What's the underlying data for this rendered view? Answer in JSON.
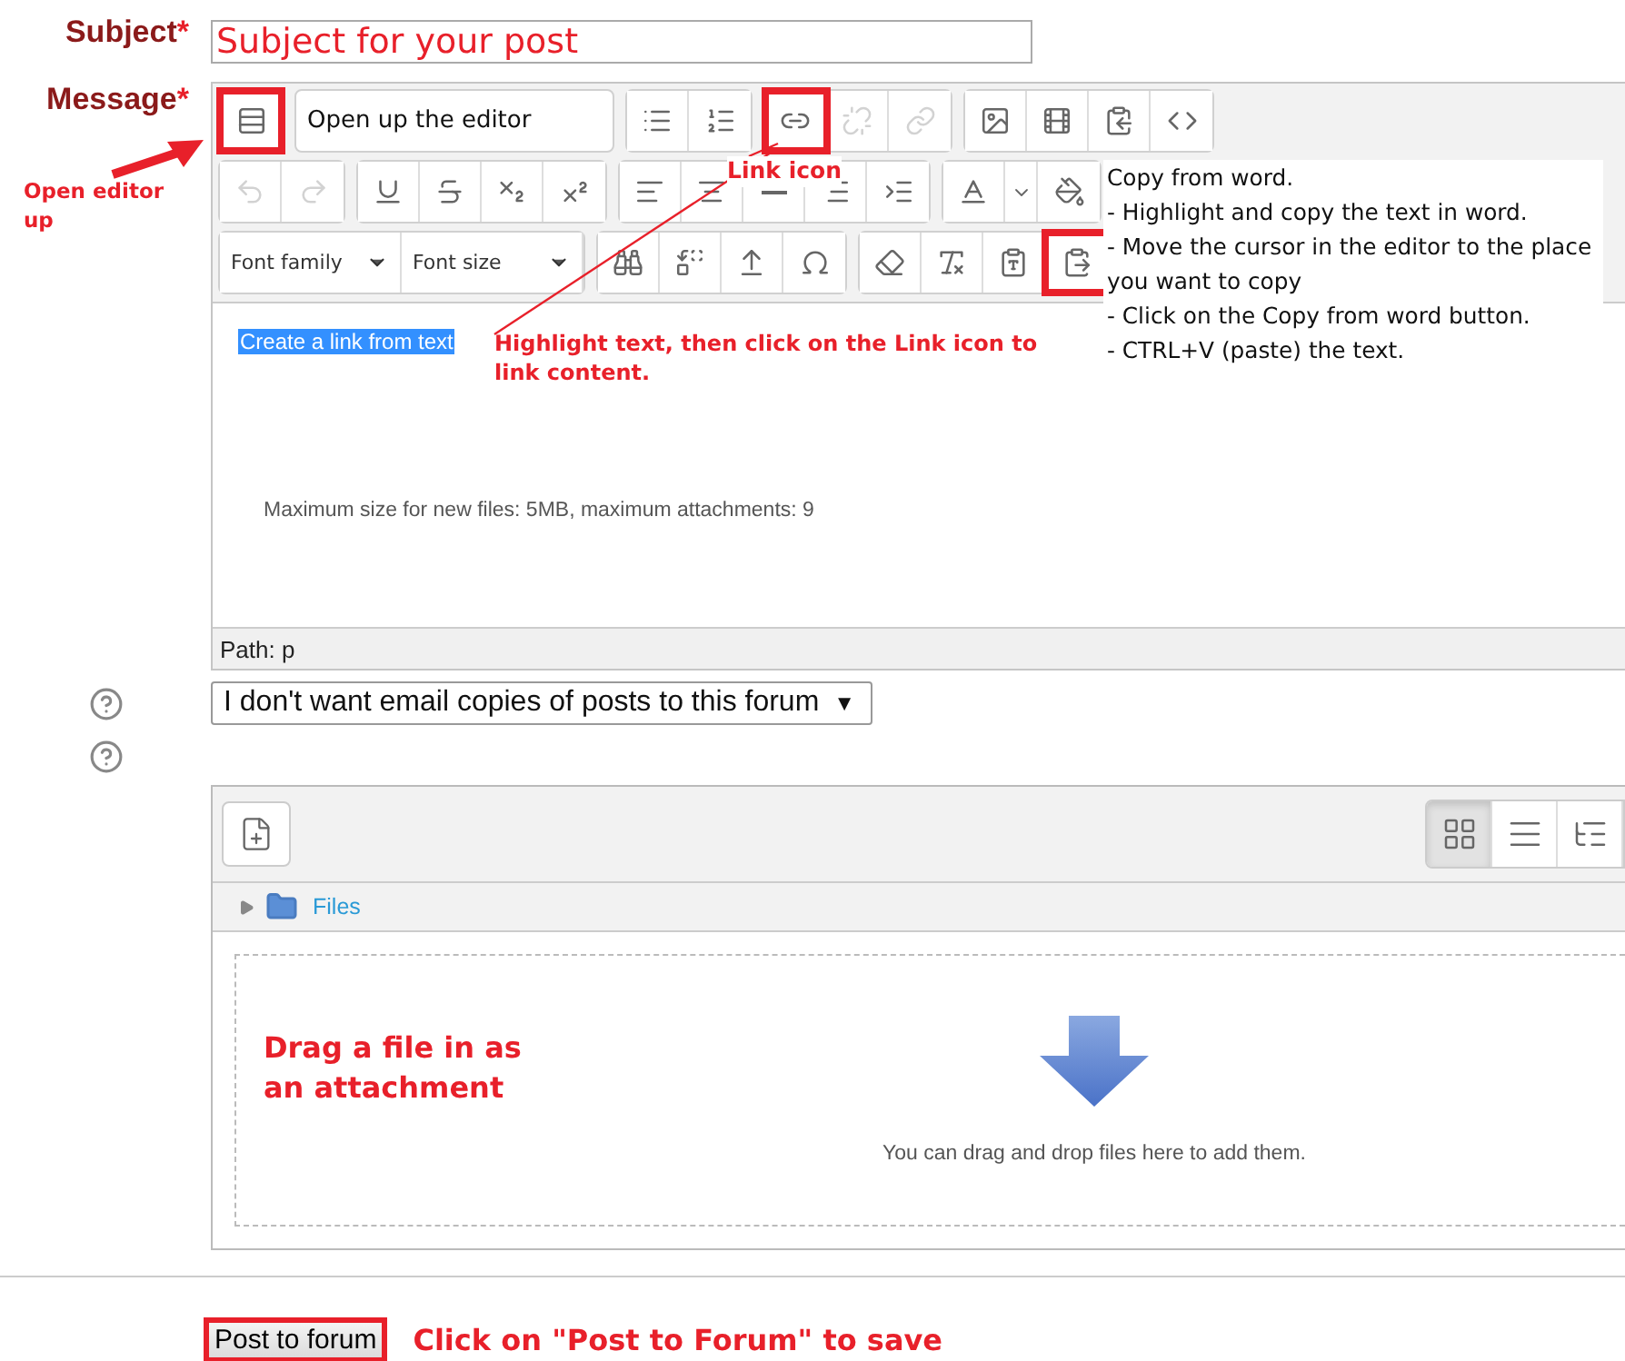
{
  "subject": {
    "label": "Subject",
    "required_mark": "*",
    "value": "Subject for your post"
  },
  "message": {
    "label": "Message",
    "required_mark": "*"
  },
  "editor": {
    "toolbar_rows": [
      {
        "groups": [
          [
            {
              "kind": "button",
              "disabled": false,
              "annotated": true
            }
          ],
          [
            {
              "kind": "note",
              "text": "Open up the editor"
            }
          ],
          [
            {
              "kind": "button",
              "disabled": false,
              "annotated": false
            },
            {
              "kind": "button",
              "disabled": false,
              "annotated": false
            }
          ],
          [
            {
              "kind": "button",
              "disabled": false,
              "annotated": true
            },
            {
              "kind": "button",
              "disabled": true,
              "annotated": false
            },
            {
              "kind": "button",
              "disabled": true,
              "annotated": false
            }
          ],
          [
            {
              "kind": "button",
              "disabled": false,
              "annotated": false
            },
            {
              "kind": "button",
              "disabled": false,
              "annotated": false
            },
            {
              "kind": "button",
              "disabled": false,
              "annotated": false
            },
            {
              "kind": "button",
              "disabled": false,
              "annotated": false
            }
          ]
        ]
      },
      {
        "groups": [
          [
            {
              "kind": "button",
              "disabled": true,
              "annotated": false
            },
            {
              "kind": "button",
              "disabled": true,
              "annotated": false
            }
          ],
          [
            {
              "kind": "button",
              "disabled": false,
              "annotated": false
            },
            {
              "kind": "button",
              "disabled": false,
              "annotated": false
            },
            {
              "kind": "button",
              "disabled": false,
              "annotated": false
            },
            {
              "kind": "button",
              "disabled": false,
              "annotated": false
            }
          ],
          [
            {
              "kind": "button",
              "annotated": false
            },
            {
              "kind": "button",
              "annotated": false
            },
            {
              "kind": "button",
              "annotated": false
            },
            {
              "kind": "button",
              "annotated": false
            },
            {
              "kind": "button",
              "annotated": false
            }
          ],
          [
            {
              "kind": "button",
              "disabled": false,
              "annotated": false
            },
            {
              "kind": "caret",
              "disabled": false,
              "annotated": false
            },
            {
              "kind": "button",
              "disabled": false,
              "annotated": false
            }
          ]
        ]
      },
      {
        "groups": [
          [
            {
              "kind": "dropdown",
              "label": "Font family"
            },
            {
              "kind": "dropdown",
              "label": "Font size"
            }
          ],
          [
            {
              "kind": "button",
              "disabled": false,
              "annotated": false
            },
            {
              "kind": "button",
              "disabled": false,
              "annotated": false
            },
            {
              "kind": "button",
              "disabled": false,
              "annotated": false
            },
            {
              "kind": "button",
              "disabled": false,
              "annotated": false
            }
          ],
          [
            {
              "kind": "button",
              "disabled": false,
              "annotated": false
            },
            {
              "kind": "button",
              "disabled": false,
              "annotated": false
            },
            {
              "kind": "button",
              "disabled": false,
              "annotated": false
            },
            {
              "kind": "button",
              "disabled": false,
              "annotated": true
            }
          ]
        ]
      }
    ],
    "content": {
      "text": "Create a link from text",
      "selected": true
    },
    "limits": "Maximum size for new files: 5MB, maximum attachments: 9",
    "path": "Path: p"
  },
  "subscription": {
    "value": "I don't want email copies of posts to this forum",
    "arrow": "▼"
  },
  "file_picker": {
    "views": [
      {
        "selected": true
      },
      {
        "selected": false
      },
      {
        "selected": false
      }
    ],
    "folder": "Files",
    "drop_hint": "You can drag and drop files here to add them."
  },
  "submit": {
    "label": "Post to forum",
    "annotated": true
  },
  "annotations": [
    {
      "lines": [
        "Open editor",
        "up"
      ]
    },
    {
      "lines": [
        "Link icon"
      ]
    },
    {
      "lines": [
        "Highlight text, then click on the Link icon to",
        "link content."
      ]
    },
    {
      "lines": [
        "Copy from word.",
        "- Highlight and copy the text in word.",
        "- Move the cursor in the editor to the place",
        "you want to copy",
        "- Click on the Copy from word button.",
        "- CTRL+V (paste) the text."
      ]
    },
    {
      "lines": [
        "Drag a file in as",
        "an attachment"
      ]
    },
    {
      "lines": [
        "Click on \"Post to Forum\" to save"
      ]
    }
  ]
}
